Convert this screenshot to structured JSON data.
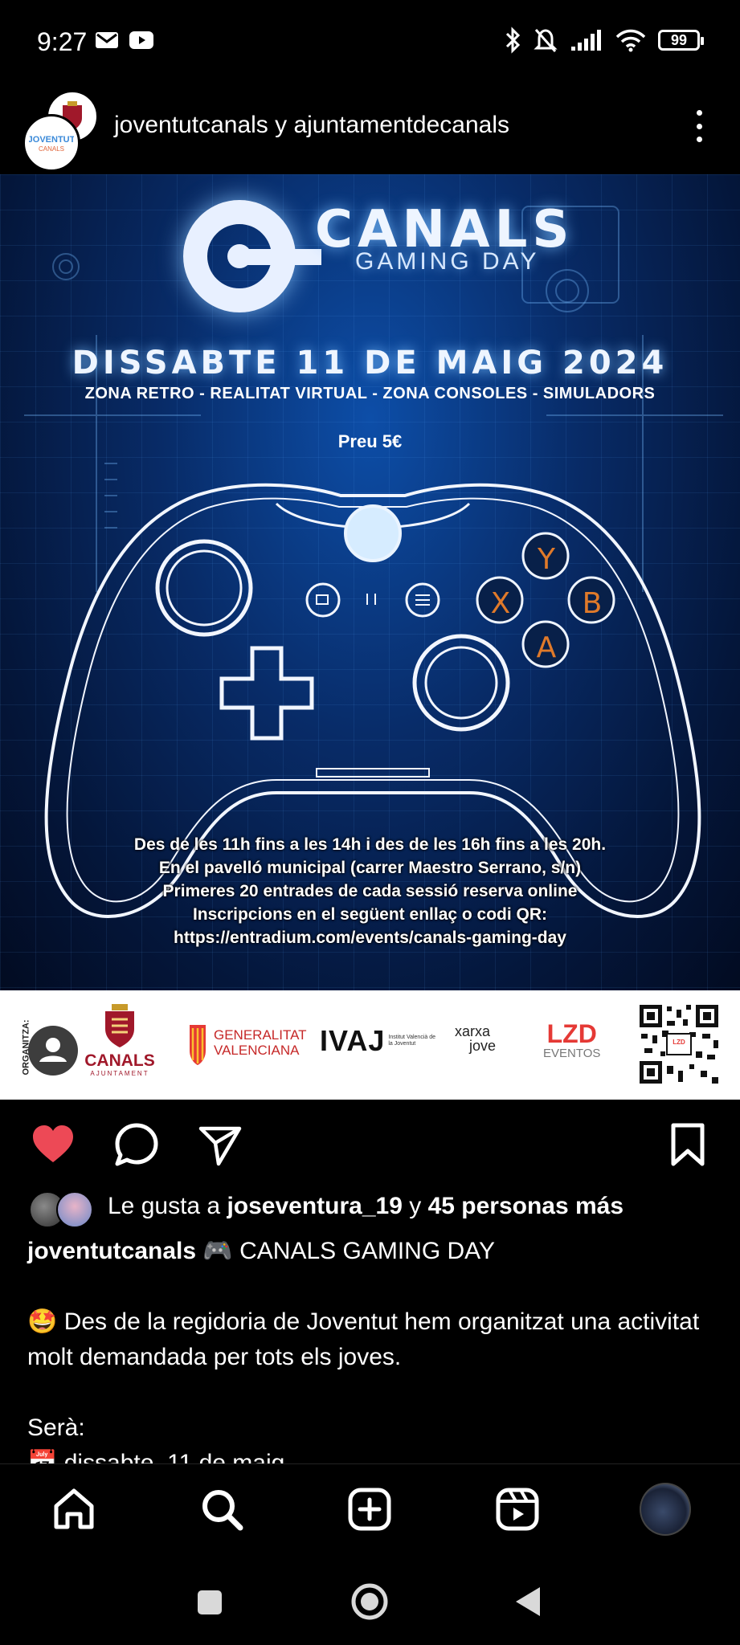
{
  "status_bar": {
    "time": "9:27",
    "battery": "99",
    "icons_left": [
      "mail-icon",
      "youtube-icon"
    ],
    "icons_right": [
      "bluetooth-icon",
      "mute-bell-icon",
      "signal-icon",
      "wifi-icon",
      "battery-icon"
    ]
  },
  "post": {
    "author": "joventutcanals y ajuntamentdecanals",
    "avatar_front_text": "JOVENTUT CANALS",
    "avatar_back_text": "CANALS"
  },
  "poster": {
    "title": "CANALS",
    "subtitle": "GAMING DAY",
    "date": "DISSABTE 11 DE MAIG 2024",
    "zones": "ZONA RETRO - REALITAT VIRTUAL - ZONA CONSOLES - SIMULADORS",
    "price": "Preu 5€",
    "buttons": {
      "y": "Y",
      "x": "X",
      "b": "B",
      "a": "A"
    },
    "info_lines": [
      "Des de les 11h fins a les 14h i des de les 16h fins a les 20h.",
      "En el pavelló municipal (carrer Maestro Serrano, s/n)",
      "Primeres 20 entrades de cada sessió reserva online",
      "Inscripcions en el següent enllaç o codi QR:",
      "https://entradium.com/events/canals-gaming-day"
    ]
  },
  "sponsors": {
    "organitza": "ORGANITZA:",
    "canals": "CANALS",
    "canals_sub": "AJUNTAMENT",
    "gva_line1": "GENERALITAT",
    "gva_line2": "VALENCIANA",
    "ivaj": "IVAJ",
    "ivaj_sub": "Institut Valencià de la Joventut",
    "xarxa_line1": "xarxa",
    "xarxa_line2": "jove",
    "lzd": "LZD",
    "lzd_sub": "EVENTOS"
  },
  "likes": {
    "prefix": "Le gusta a ",
    "user": "joseventura_19",
    "middle": " y ",
    "count_text": "45 personas más"
  },
  "caption": {
    "username": "joventutcanals",
    "title_emoji": "🎮",
    "title": "CANALS GAMING DAY",
    "body_emoji": "🤩",
    "body": "Des de la regidoria de Joventut hem organitzat una activitat molt demandada per tots els joves.",
    "sera": "Serà:",
    "date_emoji": "📅",
    "date_line": "dissabte, 11 de maig"
  },
  "colors": {
    "like_red": "#ed4956",
    "background": "#000000",
    "poster_blue": "#0d4ea8",
    "controller_button_orange": "#e07a2a"
  }
}
